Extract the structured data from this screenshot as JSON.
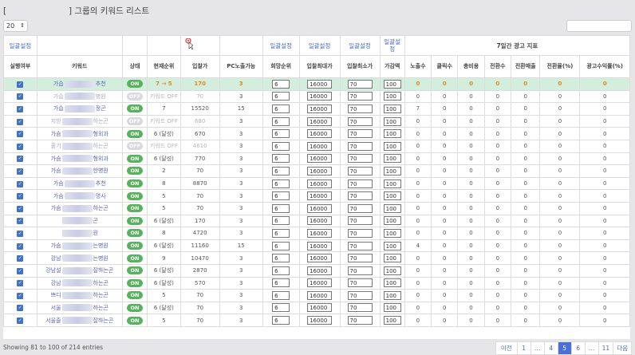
{
  "title": {
    "open_bracket": "[",
    "text": "] 그룹의 키워드 리스트"
  },
  "page_size": "20",
  "header_bulk": [
    "일괄설정",
    "일괄설정",
    "일괄설정",
    "일괄설정",
    "일괄설정",
    "일괄설\n정"
  ],
  "header_7day": "7일간 광고 지표",
  "columns": [
    "실행여부",
    "키워드",
    "상태",
    "현재순위",
    "입찰가",
    "PC노출가능",
    "희망순위",
    "입찰최대가",
    "입찰최소가",
    "가감액",
    "노출수",
    "클릭수",
    "총비용",
    "전환수",
    "전환매출",
    "전환율(%)",
    "광고수익률(%)"
  ],
  "rows": [
    {
      "kw_l": "가습",
      "kw_r": "추천",
      "status": "ON",
      "rank": "7 → 5",
      "bid": "170",
      "pc": "3",
      "hope": "6",
      "max": "16000",
      "min": "70",
      "delta": "100",
      "imp": "0",
      "clk": "0",
      "cost": "0",
      "conv": "0",
      "rev": "0",
      "cr": "0",
      "roas": "0",
      "hl": true
    },
    {
      "kw_l": "가습",
      "kw_r": "병원",
      "status": "OFF",
      "rank": "키워드 OFF",
      "bid": "70",
      "pc": "3",
      "hope": "6",
      "max": "16000",
      "min": "70",
      "delta": "100",
      "imp": "0",
      "clk": "0",
      "cost": "0",
      "conv": "0",
      "rev": "0",
      "cr": "0",
      "roas": "0"
    },
    {
      "kw_l": "가습",
      "kw_r": "정곤",
      "status": "ON",
      "rank": "7",
      "bid": "15520",
      "pc": "15",
      "hope": "6",
      "max": "16000",
      "min": "70",
      "delta": "100",
      "imp": "7",
      "clk": "0",
      "cost": "0",
      "conv": "0",
      "rev": "0",
      "cr": "0",
      "roas": "0"
    },
    {
      "kw_l": "지방",
      "kw_r": "하는곤",
      "status": "OFF",
      "rank": "키워드 OFF",
      "bid": "680",
      "pc": "3",
      "hope": "6",
      "max": "16000",
      "min": "70",
      "delta": "100",
      "imp": "0",
      "clk": "0",
      "cost": "0",
      "conv": "0",
      "rev": "0",
      "cr": "0",
      "roas": "0"
    },
    {
      "kw_l": "가슴",
      "kw_r": "형외과",
      "status": "ON",
      "rank": "6 (달성)",
      "bid": "670",
      "pc": "3",
      "hope": "6",
      "max": "16000",
      "min": "70",
      "delta": "100",
      "imp": "0",
      "clk": "0",
      "cost": "0",
      "conv": "0",
      "rev": "0",
      "cr": "0",
      "roas": "0"
    },
    {
      "kw_l": "줄기",
      "kw_r": "하는곤",
      "status": "OFF",
      "rank": "키워드 OFF",
      "bid": "4610",
      "pc": "3",
      "hope": "6",
      "max": "16000",
      "min": "70",
      "delta": "100",
      "imp": "0",
      "clk": "0",
      "cost": "0",
      "conv": "0",
      "rev": "0",
      "cr": "0",
      "roas": "0"
    },
    {
      "kw_l": "가슴",
      "kw_r": "형외과",
      "status": "ON",
      "rank": "6 (달성)",
      "bid": "770",
      "pc": "3",
      "hope": "6",
      "max": "16000",
      "min": "70",
      "delta": "100",
      "imp": "0",
      "clk": "0",
      "cost": "0",
      "conv": "0",
      "rev": "0",
      "cr": "0",
      "roas": "0"
    },
    {
      "kw_l": "가슴",
      "kw_r": "한병원",
      "status": "ON",
      "rank": "2",
      "bid": "70",
      "pc": "3",
      "hope": "6",
      "max": "16000",
      "min": "70",
      "delta": "100",
      "imp": "0",
      "clk": "0",
      "cost": "0",
      "conv": "0",
      "rev": "0",
      "cr": "0",
      "roas": "0"
    },
    {
      "kw_l": "가슴",
      "kw_r": "추천",
      "status": "ON",
      "rank": "8",
      "bid": "8870",
      "pc": "3",
      "hope": "6",
      "max": "16000",
      "min": "70",
      "delta": "100",
      "imp": "0",
      "clk": "0",
      "cost": "0",
      "conv": "0",
      "rev": "0",
      "cr": "0",
      "roas": "0"
    },
    {
      "kw_l": "가슴",
      "kw_r": "명사",
      "status": "ON",
      "rank": "5",
      "bid": "70",
      "pc": "3",
      "hope": "6",
      "max": "16000",
      "min": "70",
      "delta": "100",
      "imp": "0",
      "clk": "0",
      "cost": "0",
      "conv": "0",
      "rev": "0",
      "cr": "0",
      "roas": "0"
    },
    {
      "kw_l": "가슴",
      "kw_r": "하는곤",
      "status": "ON",
      "rank": "5",
      "bid": "70",
      "pc": "3",
      "hope": "6",
      "max": "16000",
      "min": "70",
      "delta": "100",
      "imp": "0",
      "clk": "0",
      "cost": "0",
      "conv": "0",
      "rev": "0",
      "cr": "0",
      "roas": "0"
    },
    {
      "kw_l": "",
      "kw_r": "곤",
      "status": "ON",
      "rank": "6 (달성)",
      "bid": "170",
      "pc": "3",
      "hope": "6",
      "max": "16000",
      "min": "70",
      "delta": "100",
      "imp": "0",
      "clk": "0",
      "cost": "0",
      "conv": "0",
      "rev": "0",
      "cr": "0",
      "roas": "0"
    },
    {
      "kw_l": "",
      "kw_r": "원",
      "status": "ON",
      "rank": "8",
      "bid": "4720",
      "pc": "3",
      "hope": "6",
      "max": "16000",
      "min": "70",
      "delta": "100",
      "imp": "0",
      "clk": "0",
      "cost": "0",
      "conv": "0",
      "rev": "0",
      "cr": "0",
      "roas": "0"
    },
    {
      "kw_l": "가슴",
      "kw_r": "는병원",
      "status": "ON",
      "rank": "6 (달성)",
      "bid": "11160",
      "pc": "15",
      "hope": "6",
      "max": "16000",
      "min": "70",
      "delta": "100",
      "imp": "4",
      "clk": "0",
      "cost": "0",
      "conv": "0",
      "rev": "0",
      "cr": "0",
      "roas": "0"
    },
    {
      "kw_l": "강남",
      "kw_r": "는병원",
      "status": "ON",
      "rank": "9",
      "bid": "10470",
      "pc": "3",
      "hope": "6",
      "max": "16000",
      "min": "70",
      "delta": "100",
      "imp": "0",
      "clk": "0",
      "cost": "0",
      "conv": "0",
      "rev": "0",
      "cr": "0",
      "roas": "0"
    },
    {
      "kw_l": "강남설",
      "kw_r": "잘하는곤",
      "status": "ON",
      "rank": "6 (달성)",
      "bid": "2870",
      "pc": "3",
      "hope": "6",
      "max": "16000",
      "min": "70",
      "delta": "100",
      "imp": "0",
      "clk": "0",
      "cost": "0",
      "conv": "0",
      "rev": "0",
      "cr": "0",
      "roas": "0"
    },
    {
      "kw_l": "강남",
      "kw_r": "하는곤",
      "status": "ON",
      "rank": "6 (달성)",
      "bid": "570",
      "pc": "3",
      "hope": "6",
      "max": "16000",
      "min": "70",
      "delta": "100",
      "imp": "0",
      "clk": "0",
      "cost": "0",
      "conv": "0",
      "rev": "0",
      "cr": "0",
      "roas": "0"
    },
    {
      "kw_l": "쁘디",
      "kw_r": "하는곤",
      "status": "ON",
      "rank": "5",
      "bid": "70",
      "pc": "3",
      "hope": "6",
      "max": "16000",
      "min": "70",
      "delta": "100",
      "imp": "0",
      "clk": "0",
      "cost": "0",
      "conv": "0",
      "rev": "0",
      "cr": "0",
      "roas": "0"
    },
    {
      "kw_l": "서울",
      "kw_r": "하는곤",
      "status": "ON",
      "rank": "6 (달성)",
      "bid": "70",
      "pc": "3",
      "hope": "6",
      "max": "16000",
      "min": "70",
      "delta": "100",
      "imp": "0",
      "clk": "0",
      "cost": "0",
      "conv": "0",
      "rev": "0",
      "cr": "0",
      "roas": "0"
    },
    {
      "kw_l": "서울줄",
      "kw_r": "잘하는곤",
      "status": "ON",
      "rank": "5",
      "bid": "70",
      "pc": "3",
      "hope": "6",
      "max": "16000",
      "min": "70",
      "delta": "100",
      "imp": "0",
      "clk": "0",
      "cost": "0",
      "conv": "0",
      "rev": "0",
      "cr": "0",
      "roas": "0"
    }
  ],
  "footer": "Showing 81 to 100 of 214 entries",
  "pager": [
    "이전",
    "1",
    "...",
    "4",
    "5",
    "6",
    "...",
    "11",
    "다음"
  ],
  "pager_active": "5",
  "colors": {
    "accent": "#4a6fd8",
    "on_badge": "#56b25c",
    "highlight_row": "#d3eedd"
  }
}
